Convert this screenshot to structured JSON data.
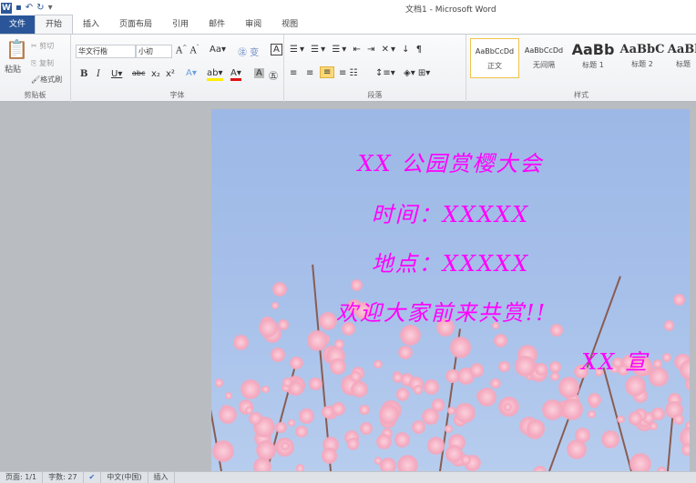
{
  "window": {
    "title": "文档1 - Microsoft Word"
  },
  "tabs": [
    "文件",
    "开始",
    "插入",
    "页面布局",
    "引用",
    "邮件",
    "审阅",
    "视图"
  ],
  "clipboard": {
    "paste": "粘贴",
    "cut": "剪切",
    "copy": "复制",
    "format_painter": "格式刷",
    "label": "剪贴板"
  },
  "font": {
    "name": "华文行楷",
    "size": "小初",
    "label": "字体"
  },
  "paragraph": {
    "label": "段落"
  },
  "styles": {
    "label": "样式",
    "items": [
      {
        "preview": "AaBbCcDd",
        "name": "正文"
      },
      {
        "preview": "AaBbCcDd",
        "name": "无间隔"
      },
      {
        "preview": "AaBb",
        "name": "标题 1"
      },
      {
        "preview": "AaBbC",
        "name": "标题 2"
      },
      {
        "preview": "AaBl",
        "name": "标题"
      }
    ]
  },
  "document": {
    "lines": [
      "XX 公园赏樱大会",
      "时间：XXXXX",
      "地点：XXXXX",
      "欢迎大家前来共赏!!",
      "XX 宣"
    ]
  },
  "status": {
    "page": "页面: 1/1",
    "words": "字数: 27",
    "language": "中文(中国)",
    "mode": "插入"
  },
  "colors": {
    "text": "#ff00ff",
    "file_tab": "#2a5699"
  }
}
